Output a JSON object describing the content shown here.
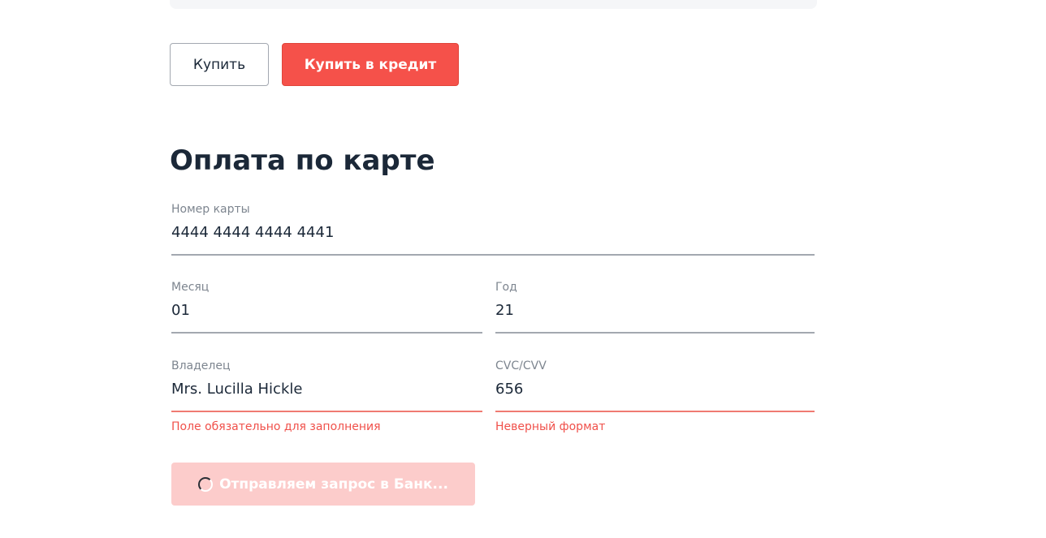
{
  "top_card": {},
  "buttons": {
    "buy_label": "Купить",
    "credit_label": "Купить в кредит"
  },
  "form": {
    "title": "Оплата по карте",
    "card_number": {
      "label": "Номер карты",
      "value": "4444 4444 4444 4441"
    },
    "month": {
      "label": "Месяц",
      "value": "01"
    },
    "year": {
      "label": "Год",
      "value": "21"
    },
    "owner": {
      "label": "Владелец",
      "value": "Mrs. Lucilla Hickle",
      "error": "Поле обязательно для заполнения"
    },
    "cvc": {
      "label": "CVC/CVV",
      "value": "656",
      "error": "Неверный формат"
    },
    "submit_label": "Отправляем запрос в Банк..."
  },
  "colors": {
    "accent": "#f5514a",
    "submit_disabled": "#fccccb",
    "error_text": "#f0504a",
    "heading": "#1b2838"
  }
}
